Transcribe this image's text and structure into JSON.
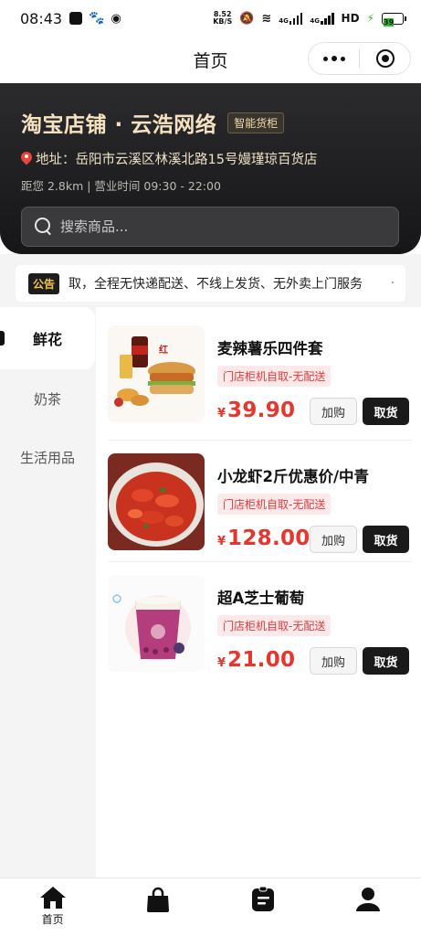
{
  "status_bar": {
    "time": "08:43",
    "net_speed_value": "8.52",
    "net_speed_unit": "KB/S",
    "signal_1": "4G",
    "signal_2": "4G",
    "hd_label": "HD",
    "battery": "39"
  },
  "nav": {
    "title": "首页",
    "icons": [
      "more-icon",
      "target-icon"
    ]
  },
  "store": {
    "name": "淘宝店铺 · 云浩网络",
    "badge": "智能货柜",
    "address": "地址：岳阳市云溪区林溪北路15号嫚瑾琼百货店",
    "info": "距您 2.8km | 营业时间 09:30 - 22:00"
  },
  "search": {
    "placeholder": "搜索商品..."
  },
  "notice": {
    "tag": "公告",
    "text": "取，全程无快递配送、不线上发货、无外卖上门服务"
  },
  "categories": [
    {
      "label": "鲜花",
      "active": true
    },
    {
      "label": "奶茶",
      "active": false
    },
    {
      "label": "生活用品",
      "active": false
    }
  ],
  "products": [
    {
      "name": "麦辣薯乐四件套",
      "tag": "门店柜机自取-无配送",
      "currency": "¥",
      "price": "39.90",
      "add_label": "加购",
      "get_label": "取货"
    },
    {
      "name": "小龙虾2斤优惠价/中青",
      "tag": "门店柜机自取-无配送",
      "currency": "¥",
      "price": "128.00",
      "add_label": "加购",
      "get_label": "取货"
    },
    {
      "name": "超A芝士葡萄",
      "tag": "门店柜机自取-无配送",
      "currency": "¥",
      "price": "21.00",
      "add_label": "加购",
      "get_label": "取货"
    }
  ],
  "tabbar": {
    "items": [
      {
        "label": "首页",
        "icon": "home-icon",
        "active": true
      },
      {
        "label": "",
        "icon": "bag-icon",
        "active": false
      },
      {
        "label": "",
        "icon": "order-icon",
        "active": false
      },
      {
        "label": "",
        "icon": "user-icon",
        "active": false
      }
    ]
  },
  "colors": {
    "accent_price": "#e8352e",
    "header_bg": "#1c1c1e",
    "store_name": "#f6e2c0",
    "notice_tag_text": "#f3c64b"
  }
}
